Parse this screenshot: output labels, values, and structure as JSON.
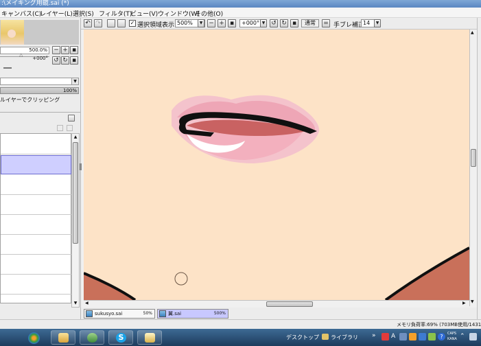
{
  "window": {
    "title": ":\\メイキング用鏡.sai (*)"
  },
  "menu": {
    "items": [
      "キャンバス(C)",
      "レイヤー(L)",
      "選択(S)",
      "フィルタ(T)",
      "ビュー(V)",
      "ウィンドウ(W)",
      "その他(O)"
    ]
  },
  "navigator": {
    "zoom": "500.0%",
    "angle": "+000°"
  },
  "layer_panel": {
    "opacity_value": "100%",
    "clipping_label": "ルイヤーでクリッピング"
  },
  "toolbar": {
    "show_selection_label": "選択領域表示",
    "show_selection_checked": true,
    "zoom_value": "500%",
    "angle_value": "+000°",
    "blend_label": "通常",
    "stabilizer_label": "手ブレ補正",
    "stabilizer_value": "14"
  },
  "doc_tabs": [
    {
      "name": "sukusyo.sai",
      "zoom": "50%",
      "active": false
    },
    {
      "name": "翼.sai",
      "zoom": "500%",
      "active": true
    }
  ],
  "status": {
    "memory": "メモリ負荷率:69% (703MB使用/1431M"
  },
  "taskbar": {
    "desktop_label": "デスクトップ",
    "library_label": "ライブラリ",
    "caps_label": "CAPS",
    "kana_label": "KANA"
  },
  "colors": {
    "canvas_skin": "#fde3c7",
    "lip_pink": "#f2a7b8",
    "selected_layer": "#cfcfff"
  }
}
